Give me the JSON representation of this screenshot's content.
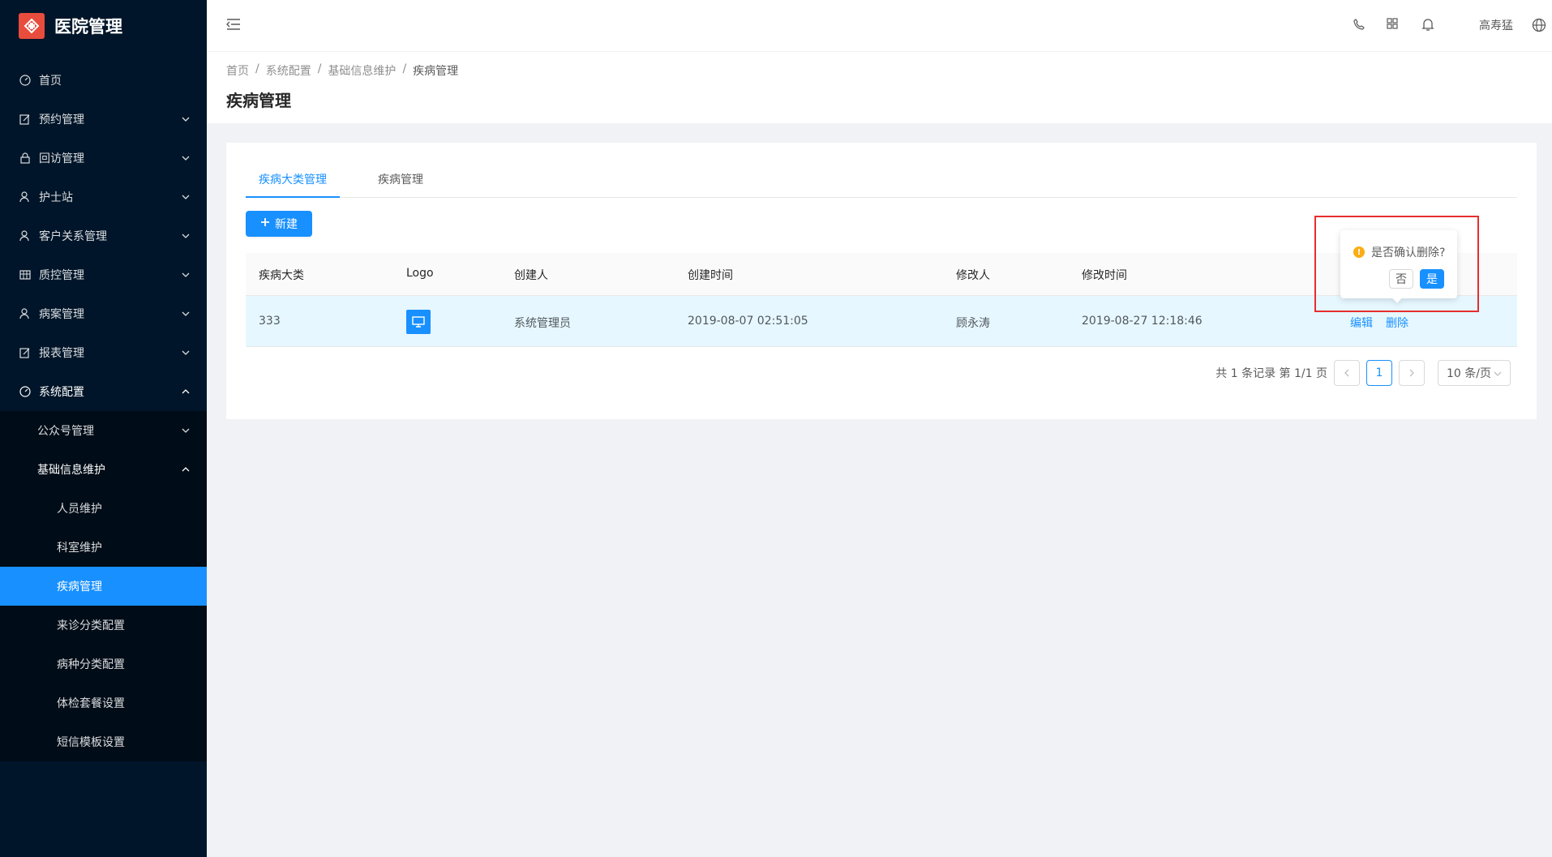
{
  "app": {
    "title": "医院管理",
    "brand_color": "#e84c3d",
    "accent": "#1890ff"
  },
  "sidebar": {
    "items": [
      {
        "label": "首页",
        "icon": "dashboard-icon",
        "has_arrow": false
      },
      {
        "label": "预约管理",
        "icon": "edit-icon",
        "has_arrow": true
      },
      {
        "label": "回访管理",
        "icon": "lock-icon",
        "has_arrow": true
      },
      {
        "label": "护士站",
        "icon": "user-icon",
        "has_arrow": true
      },
      {
        "label": "客户关系管理",
        "icon": "user-icon",
        "has_arrow": true
      },
      {
        "label": "质控管理",
        "icon": "table-icon",
        "has_arrow": true
      },
      {
        "label": "病案管理",
        "icon": "user-icon",
        "has_arrow": true
      },
      {
        "label": "报表管理",
        "icon": "edit-icon",
        "has_arrow": true
      },
      {
        "label": "系统配置",
        "icon": "dashboard-icon",
        "has_arrow": true,
        "open": true
      }
    ],
    "sub": [
      {
        "label": "公众号管理"
      },
      {
        "label": "基础信息维护",
        "open": true
      }
    ],
    "leaf": [
      {
        "label": "人员维护"
      },
      {
        "label": "科室维护"
      },
      {
        "label": "疾病管理",
        "active": true
      },
      {
        "label": "来诊分类配置"
      },
      {
        "label": "病种分类配置"
      },
      {
        "label": "体检套餐设置"
      },
      {
        "label": "短信模板设置"
      }
    ]
  },
  "header": {
    "username": "高寿猛"
  },
  "breadcrumb": [
    "首页",
    "系统配置",
    "基础信息维护",
    "疾病管理"
  ],
  "page_title": "疾病管理",
  "tabs": [
    "疾病大类管理",
    "疾病管理"
  ],
  "new_button": "新建",
  "table": {
    "columns": [
      "疾病大类",
      "Logo",
      "创建人",
      "创建时间",
      "修改人",
      "修改时间"
    ],
    "rows": [
      {
        "category": "333",
        "creator": "系统管理员",
        "created": "2019-08-07 02:51:05",
        "modifier": "顾永涛",
        "modified": "2019-08-27 12:18:46",
        "edit": "编辑",
        "delete": "删除"
      }
    ]
  },
  "pagination": {
    "summary": "共 1 条记录 第 1/1 页",
    "current": "1",
    "page_size": "10 条/页"
  },
  "popconfirm": {
    "message": "是否确认删除?",
    "no": "否",
    "yes": "是"
  }
}
